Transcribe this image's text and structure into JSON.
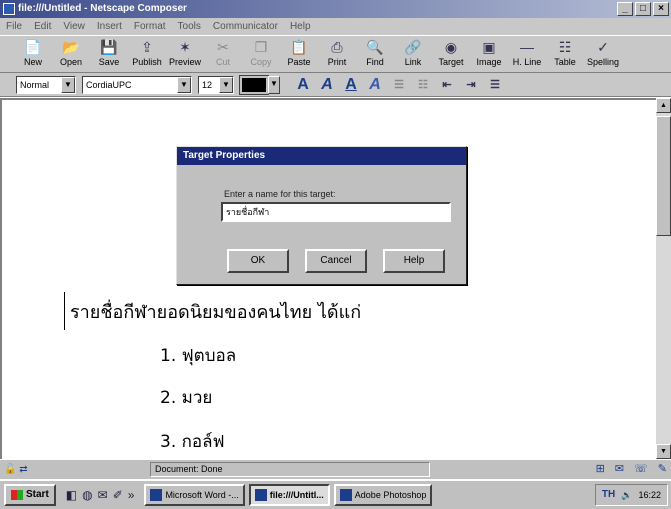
{
  "window": {
    "title": "file:///Untitled - Netscape Composer",
    "min": "_",
    "max": "□",
    "close": "×"
  },
  "menu": [
    "File",
    "Edit",
    "View",
    "Insert",
    "Format",
    "Tools",
    "Communicator",
    "Help"
  ],
  "toolbar": [
    {
      "label": "New",
      "icon": "📄",
      "name": "new"
    },
    {
      "label": "Open",
      "icon": "📂",
      "name": "open"
    },
    {
      "label": "Save",
      "icon": "💾",
      "name": "save"
    },
    {
      "label": "Publish",
      "icon": "⇪",
      "name": "publish"
    },
    {
      "label": "Preview",
      "icon": "✶",
      "name": "preview"
    },
    {
      "label": "Cut",
      "icon": "✂",
      "name": "cut",
      "disabled": true
    },
    {
      "label": "Copy",
      "icon": "❐",
      "name": "copy",
      "disabled": true
    },
    {
      "label": "Paste",
      "icon": "📋",
      "name": "paste"
    },
    {
      "label": "Print",
      "icon": "⎙",
      "name": "print"
    },
    {
      "label": "Find",
      "icon": "🔍",
      "name": "find"
    },
    {
      "label": "Link",
      "icon": "🔗",
      "name": "link"
    },
    {
      "label": "Target",
      "icon": "◉",
      "name": "target"
    },
    {
      "label": "Image",
      "icon": "▣",
      "name": "image"
    },
    {
      "label": "H. Line",
      "icon": "—",
      "name": "h-line"
    },
    {
      "label": "Table",
      "icon": "☷",
      "name": "table"
    },
    {
      "label": "Spelling",
      "icon": "✓",
      "name": "spelling"
    }
  ],
  "format": {
    "paragraph_style": "Normal",
    "font": "CordiaUPC",
    "size": "12"
  },
  "document": {
    "heading": "รายชื่อกีฬายอดนิยมของคนไทย ได้แก่",
    "items": [
      "1. ฟุตบอล",
      "2. มวย",
      "3. กอล์ฟ"
    ]
  },
  "dialog": {
    "title": "Target Properties",
    "prompt": "Enter a name for this target:",
    "value": "รายชื่อกีฬา",
    "ok": "OK",
    "cancel": "Cancel",
    "help": "Help"
  },
  "status": {
    "text": "Document: Done"
  },
  "taskbar": {
    "start": "Start",
    "tasks": [
      {
        "label": "Microsoft Word -...",
        "active": false
      },
      {
        "label": "file:///Untitl...",
        "active": true
      },
      {
        "label": "Adobe Photoshop",
        "active": false
      }
    ],
    "clock": "16:22"
  }
}
